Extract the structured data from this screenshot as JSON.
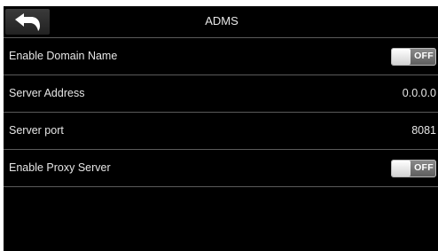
{
  "header": {
    "title": "ADMS",
    "back_icon": "back-arrow-icon"
  },
  "settings": [
    {
      "label": "Enable Domain Name",
      "type": "toggle",
      "state": "OFF"
    },
    {
      "label": "Server Address",
      "type": "value",
      "value": "0.0.0.0"
    },
    {
      "label": "Server port",
      "type": "value",
      "value": "8081"
    },
    {
      "label": "Enable Proxy Server",
      "type": "toggle",
      "state": "OFF"
    }
  ],
  "colors": {
    "background": "#000000",
    "divider": "#5a5a5a",
    "text": "#e6e6e6"
  }
}
